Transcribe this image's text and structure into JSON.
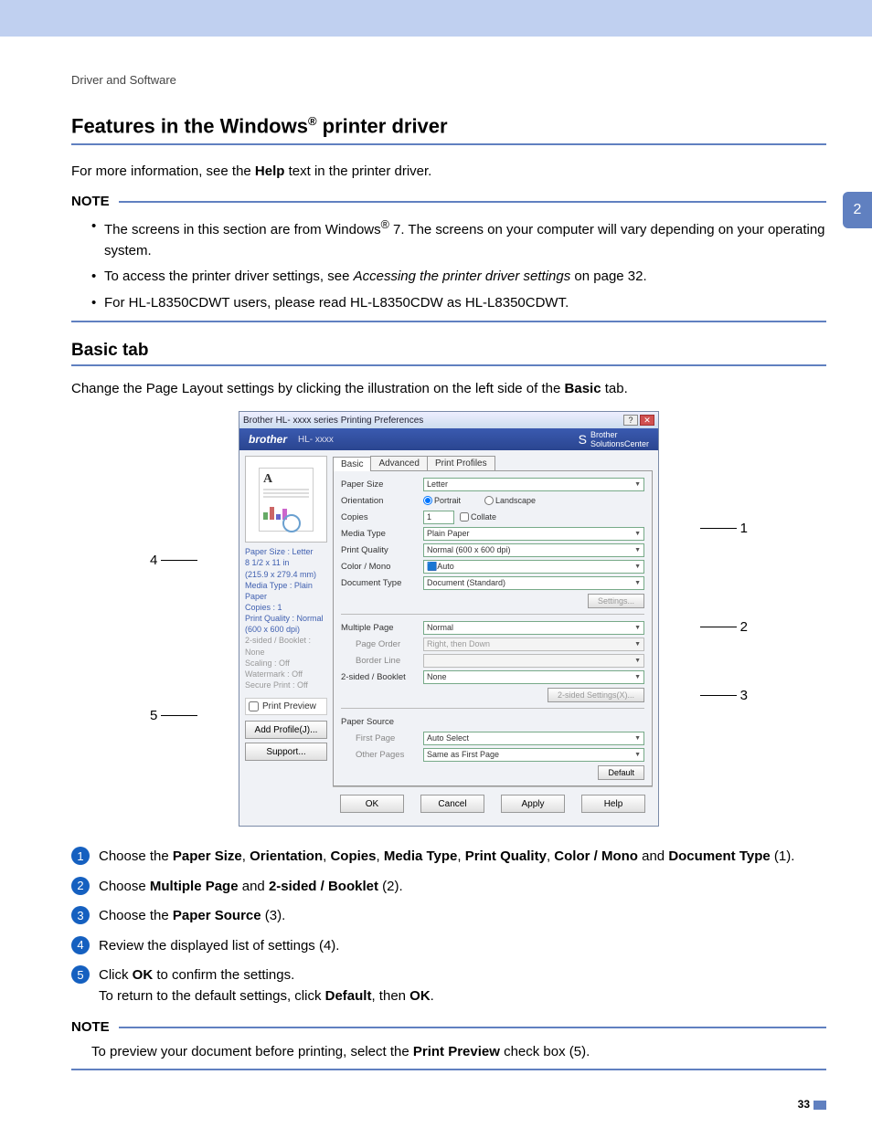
{
  "breadcrumb": "Driver and Software",
  "chapter": "2",
  "h1_a": "Features in the Windows",
  "h1_b": " printer driver",
  "intro_a": "For more information, see the ",
  "intro_b": "Help",
  "intro_c": " text in the printer driver.",
  "note_label": "NOTE",
  "note1_a": "The screens in this section are from Windows",
  "note1_b": " 7. The screens on your computer will vary depending on your operating system.",
  "note2_a": "To access the printer driver settings, see ",
  "note2_i": "Accessing the printer driver settings",
  "note2_b": " on page 32.",
  "note3": "For HL-L8350CDWT users, please read HL-L8350CDW as HL-L8350CDWT.",
  "h2": "Basic tab",
  "basic_intro_a": "Change the Page Layout settings by clicking the illustration on the left side of the ",
  "basic_intro_b": "Basic",
  "basic_intro_c": " tab.",
  "dialog": {
    "title": "Brother HL- xxxx  series Printing Preferences",
    "brand": "brother",
    "model": "HL- xxxx",
    "sol_a": "Brother",
    "sol_b": "SolutionsCenter",
    "tabs": {
      "basic": "Basic",
      "advanced": "Advanced",
      "profiles": "Print Profiles"
    },
    "labels": {
      "paper_size": "Paper Size",
      "orientation": "Orientation",
      "copies": "Copies",
      "media_type": "Media Type",
      "print_quality": "Print Quality",
      "color_mono": "Color / Mono",
      "doc_type": "Document Type",
      "multiple_page": "Multiple Page",
      "page_order": "Page Order",
      "border_line": "Border Line",
      "two_sided": "2-sided / Booklet",
      "paper_source": "Paper Source",
      "first_page": "First Page",
      "other_pages": "Other Pages"
    },
    "values": {
      "paper_size": "Letter",
      "portrait": "Portrait",
      "landscape": "Landscape",
      "copies": "1",
      "collate": "Collate",
      "media_type": "Plain Paper",
      "print_quality": "Normal (600 x 600 dpi)",
      "color_mono": "Auto",
      "doc_type": "Document (Standard)",
      "settings_btn": "Settings...",
      "multiple_page": "Normal",
      "page_order": "Right, then Down",
      "two_sided": "None",
      "two_sided_btn": "2-sided Settings(X)...",
      "first_page": "Auto Select",
      "other_pages": "Same as First Page",
      "default_btn": "Default"
    },
    "side": {
      "s1": "Paper Size : Letter",
      "s2": "8 1/2 x 11 in",
      "s3": "(215.9 x 279.4 mm)",
      "s4": "Media Type : Plain Paper",
      "s5": "Copies : 1",
      "s6": "Print Quality : Normal (600 x 600 dpi)",
      "d1": "2-sided / Booklet : None",
      "d2": "Scaling : Off",
      "d3": "Watermark : Off",
      "d4": "Secure Print : Off"
    },
    "print_preview": "Print Preview",
    "add_profile": "Add Profile(J)...",
    "support": "Support...",
    "ok": "OK",
    "cancel": "Cancel",
    "apply": "Apply",
    "help": "Help"
  },
  "callouts": {
    "c1": "1",
    "c2": "2",
    "c3": "3",
    "c4": "4",
    "c5": "5"
  },
  "steps": {
    "s1_a": "Choose the ",
    "s1_b": "Paper Size",
    "s1_c": ", ",
    "s1_d": "Orientation",
    "s1_e": ", ",
    "s1_f": "Copies",
    "s1_g": ", ",
    "s1_h": "Media Type",
    "s1_i": ", ",
    "s1_j": "Print Quality",
    "s1_k": ", ",
    "s1_l": "Color / Mono",
    "s1_m": " and ",
    "s1_n": "Document Type",
    "s1_o": " (1).",
    "s2_a": "Choose ",
    "s2_b": "Multiple Page",
    "s2_c": " and ",
    "s2_d": "2-sided / Booklet",
    "s2_e": " (2).",
    "s3_a": "Choose the ",
    "s3_b": "Paper Source",
    "s3_c": " (3).",
    "s4": "Review the displayed list of settings (4).",
    "s5_a": "Click ",
    "s5_b": "OK",
    "s5_c": " to confirm the settings.",
    "s5_d": "To return to the default settings, click ",
    "s5_e": "Default",
    "s5_f": ", then ",
    "s5_g": "OK",
    "s5_h": "."
  },
  "note2_body_a": "To preview your document before printing, select the ",
  "note2_body_b": "Print Preview",
  "note2_body_c": " check box (5).",
  "pagenum": "33"
}
